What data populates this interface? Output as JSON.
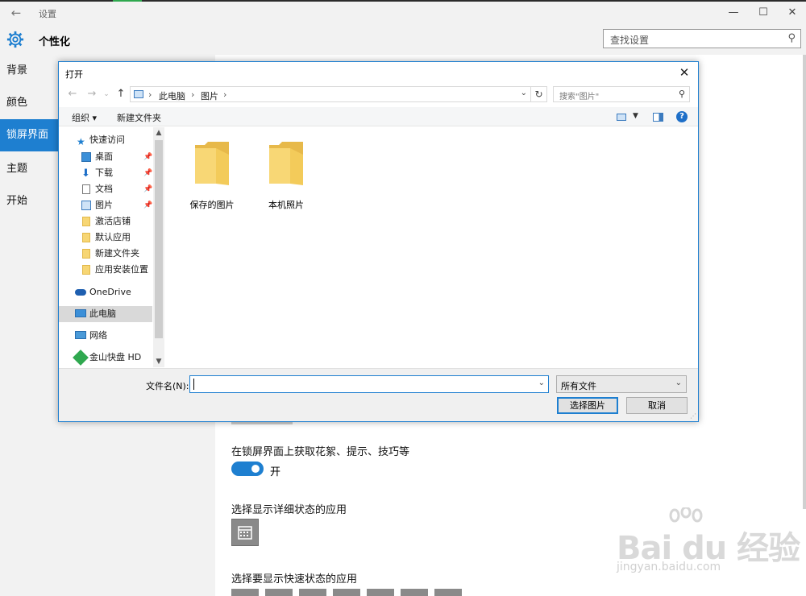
{
  "window": {
    "title": "设置",
    "section_title": "个性化",
    "search_placeholder": "查找设置",
    "icons": [
      "back-arrow-icon",
      "minimize-icon",
      "maximize-icon",
      "close-icon",
      "gear-icon",
      "search-icon"
    ]
  },
  "sidebar": {
    "items": [
      {
        "label": "背景"
      },
      {
        "label": "颜色"
      },
      {
        "label": "锁屏界面",
        "selected": true
      },
      {
        "label": "主题"
      },
      {
        "label": "开始"
      }
    ]
  },
  "main": {
    "tips_label": "在锁屏界面上获取花絮、提示、技巧等",
    "tips_toggle": "开",
    "detail_label": "选择显示详细状态的应用",
    "quick_label": "选择要显示快速状态的应用"
  },
  "dialog": {
    "title": "打开",
    "breadcrumb": [
      "此电脑",
      "图片"
    ],
    "search_placeholder": "搜索\"图片\"",
    "toolbar": {
      "organize": "组织 ▾",
      "new_folder": "新建文件夹"
    },
    "tree": [
      {
        "label": "快速访问",
        "icon": "star-icon"
      },
      {
        "label": "桌面",
        "icon": "desktop-icon",
        "pinned": true
      },
      {
        "label": "下载",
        "icon": "download-icon",
        "pinned": true
      },
      {
        "label": "文档",
        "icon": "document-icon",
        "pinned": true
      },
      {
        "label": "图片",
        "icon": "pictures-icon",
        "pinned": true
      },
      {
        "label": "激活店铺",
        "icon": "folder-icon"
      },
      {
        "label": "默认应用",
        "icon": "folder-icon"
      },
      {
        "label": "新建文件夹",
        "icon": "folder-icon"
      },
      {
        "label": "应用安装位置",
        "icon": "folder-icon"
      },
      {
        "label": "OneDrive",
        "icon": "cloud-icon"
      },
      {
        "label": "此电脑",
        "icon": "computer-icon",
        "selected": true
      },
      {
        "label": "网络",
        "icon": "network-icon"
      },
      {
        "label": "金山快盘 HD",
        "icon": "kuaipan-icon"
      }
    ],
    "files": [
      {
        "name": "保存的图片"
      },
      {
        "name": "本机照片"
      }
    ],
    "filename_label": "文件名(N):",
    "filename_value": "",
    "filter": "所有文件",
    "open_button": "选择图片",
    "cancel_button": "取消"
  },
  "watermark": {
    "main": "Bai du 经验",
    "sub": "jingyan.baidu.com"
  },
  "colors": {
    "accent": "#1e7fd0",
    "sidebar_bg": "#f2f2f2",
    "folder": "#f7d674"
  }
}
